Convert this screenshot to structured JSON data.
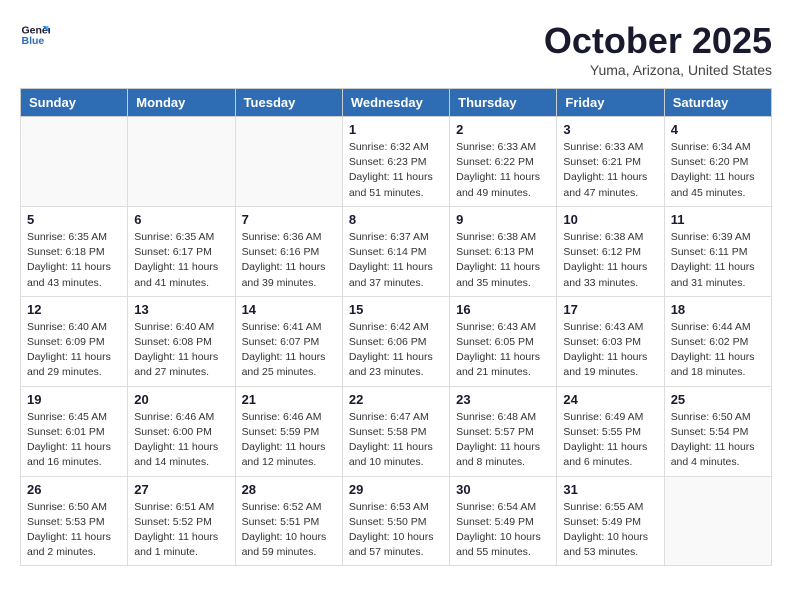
{
  "logo": {
    "line1": "General",
    "line2": "Blue"
  },
  "title": "October 2025",
  "location": "Yuma, Arizona, United States",
  "days_of_week": [
    "Sunday",
    "Monday",
    "Tuesday",
    "Wednesday",
    "Thursday",
    "Friday",
    "Saturday"
  ],
  "weeks": [
    [
      {
        "day": "",
        "info": ""
      },
      {
        "day": "",
        "info": ""
      },
      {
        "day": "",
        "info": ""
      },
      {
        "day": "1",
        "info": "Sunrise: 6:32 AM\nSunset: 6:23 PM\nDaylight: 11 hours\nand 51 minutes."
      },
      {
        "day": "2",
        "info": "Sunrise: 6:33 AM\nSunset: 6:22 PM\nDaylight: 11 hours\nand 49 minutes."
      },
      {
        "day": "3",
        "info": "Sunrise: 6:33 AM\nSunset: 6:21 PM\nDaylight: 11 hours\nand 47 minutes."
      },
      {
        "day": "4",
        "info": "Sunrise: 6:34 AM\nSunset: 6:20 PM\nDaylight: 11 hours\nand 45 minutes."
      }
    ],
    [
      {
        "day": "5",
        "info": "Sunrise: 6:35 AM\nSunset: 6:18 PM\nDaylight: 11 hours\nand 43 minutes."
      },
      {
        "day": "6",
        "info": "Sunrise: 6:35 AM\nSunset: 6:17 PM\nDaylight: 11 hours\nand 41 minutes."
      },
      {
        "day": "7",
        "info": "Sunrise: 6:36 AM\nSunset: 6:16 PM\nDaylight: 11 hours\nand 39 minutes."
      },
      {
        "day": "8",
        "info": "Sunrise: 6:37 AM\nSunset: 6:14 PM\nDaylight: 11 hours\nand 37 minutes."
      },
      {
        "day": "9",
        "info": "Sunrise: 6:38 AM\nSunset: 6:13 PM\nDaylight: 11 hours\nand 35 minutes."
      },
      {
        "day": "10",
        "info": "Sunrise: 6:38 AM\nSunset: 6:12 PM\nDaylight: 11 hours\nand 33 minutes."
      },
      {
        "day": "11",
        "info": "Sunrise: 6:39 AM\nSunset: 6:11 PM\nDaylight: 11 hours\nand 31 minutes."
      }
    ],
    [
      {
        "day": "12",
        "info": "Sunrise: 6:40 AM\nSunset: 6:09 PM\nDaylight: 11 hours\nand 29 minutes."
      },
      {
        "day": "13",
        "info": "Sunrise: 6:40 AM\nSunset: 6:08 PM\nDaylight: 11 hours\nand 27 minutes."
      },
      {
        "day": "14",
        "info": "Sunrise: 6:41 AM\nSunset: 6:07 PM\nDaylight: 11 hours\nand 25 minutes."
      },
      {
        "day": "15",
        "info": "Sunrise: 6:42 AM\nSunset: 6:06 PM\nDaylight: 11 hours\nand 23 minutes."
      },
      {
        "day": "16",
        "info": "Sunrise: 6:43 AM\nSunset: 6:05 PM\nDaylight: 11 hours\nand 21 minutes."
      },
      {
        "day": "17",
        "info": "Sunrise: 6:43 AM\nSunset: 6:03 PM\nDaylight: 11 hours\nand 19 minutes."
      },
      {
        "day": "18",
        "info": "Sunrise: 6:44 AM\nSunset: 6:02 PM\nDaylight: 11 hours\nand 18 minutes."
      }
    ],
    [
      {
        "day": "19",
        "info": "Sunrise: 6:45 AM\nSunset: 6:01 PM\nDaylight: 11 hours\nand 16 minutes."
      },
      {
        "day": "20",
        "info": "Sunrise: 6:46 AM\nSunset: 6:00 PM\nDaylight: 11 hours\nand 14 minutes."
      },
      {
        "day": "21",
        "info": "Sunrise: 6:46 AM\nSunset: 5:59 PM\nDaylight: 11 hours\nand 12 minutes."
      },
      {
        "day": "22",
        "info": "Sunrise: 6:47 AM\nSunset: 5:58 PM\nDaylight: 11 hours\nand 10 minutes."
      },
      {
        "day": "23",
        "info": "Sunrise: 6:48 AM\nSunset: 5:57 PM\nDaylight: 11 hours\nand 8 minutes."
      },
      {
        "day": "24",
        "info": "Sunrise: 6:49 AM\nSunset: 5:55 PM\nDaylight: 11 hours\nand 6 minutes."
      },
      {
        "day": "25",
        "info": "Sunrise: 6:50 AM\nSunset: 5:54 PM\nDaylight: 11 hours\nand 4 minutes."
      }
    ],
    [
      {
        "day": "26",
        "info": "Sunrise: 6:50 AM\nSunset: 5:53 PM\nDaylight: 11 hours\nand 2 minutes."
      },
      {
        "day": "27",
        "info": "Sunrise: 6:51 AM\nSunset: 5:52 PM\nDaylight: 11 hours\nand 1 minute."
      },
      {
        "day": "28",
        "info": "Sunrise: 6:52 AM\nSunset: 5:51 PM\nDaylight: 10 hours\nand 59 minutes."
      },
      {
        "day": "29",
        "info": "Sunrise: 6:53 AM\nSunset: 5:50 PM\nDaylight: 10 hours\nand 57 minutes."
      },
      {
        "day": "30",
        "info": "Sunrise: 6:54 AM\nSunset: 5:49 PM\nDaylight: 10 hours\nand 55 minutes."
      },
      {
        "day": "31",
        "info": "Sunrise: 6:55 AM\nSunset: 5:49 PM\nDaylight: 10 hours\nand 53 minutes."
      },
      {
        "day": "",
        "info": ""
      }
    ]
  ]
}
